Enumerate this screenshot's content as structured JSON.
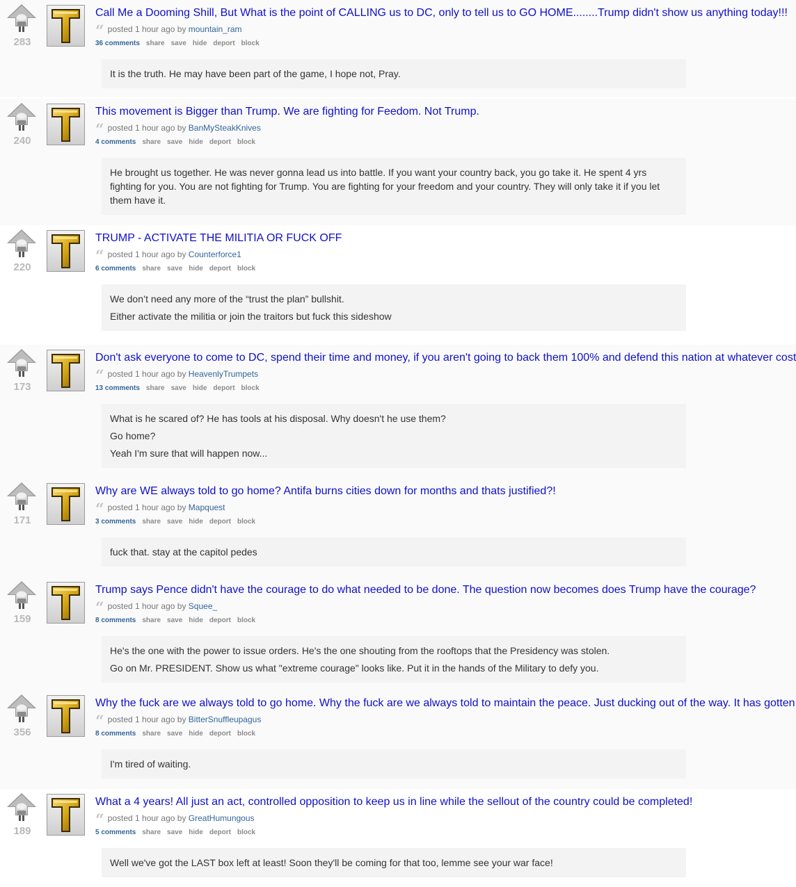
{
  "colors": {
    "title_link": "#1010c8",
    "author_link": "#336699",
    "score": "#b9b9b9",
    "body_background": "#f3f3f3",
    "thumbnail_gold": "#d4a514"
  },
  "icons": {
    "upvote": "upvote-arrow-icon",
    "quote": "quote-icon",
    "thumbnail": "gold-t-thumbnail-icon"
  },
  "labels": {
    "posted_prefix": "posted",
    "by": "by",
    "actions": [
      "share",
      "save",
      "hide",
      "deport",
      "block"
    ]
  },
  "posts": [
    {
      "score": "283",
      "title": "Call Me a Dooming Shill, But What is the point of CALLING us to DC, only to tell us to GO HOME........Trump didn't show us anything today!!!",
      "time": "1 hour ago",
      "author": "mountain_ram",
      "comments": "36 comments",
      "body": [
        "It is the truth. He may have been part of the game, I hope not, Pray."
      ]
    },
    {
      "score": "240",
      "title": "This movement is Bigger than Trump. We are fighting for Feedom. Not Trump.",
      "time": "1 hour ago",
      "author": "BanMySteakKnives",
      "comments": "4 comments",
      "body": [
        "He brought us together. He was never gonna lead us into battle. If you want your country back, you go take it. He spent 4 yrs fighting for you. You are not fighting for Trump. You are fighting for your freedom and your country. They will only take it if you let them have it."
      ]
    },
    {
      "score": "220",
      "title": "TRUMP - ACTIVATE THE MILITIA OR FUCK OFF",
      "time": "1 hour ago",
      "author": "Counterforce1",
      "comments": "6 comments",
      "body": [
        "We don’t need any more of the “trust the plan” bullshit.",
        "Either activate the militia or join the traitors but fuck this sideshow"
      ]
    },
    {
      "score": "173",
      "title": "Don't ask everyone to come to DC, spend their time and money, if you aren't going to back them 100% and defend this nation at whatever cost",
      "time": "1 hour ago",
      "author": "HeavenlyTrumpets",
      "comments": "13 comments",
      "body": [
        "What is he scared of? He has tools at his disposal. Why doesn't he use them?",
        "Go home?",
        "Yeah I'm sure that will happen now..."
      ]
    },
    {
      "score": "171",
      "title": "Why are WE always told to go home? Antifa burns cities down for months and thats justified?!",
      "time": "1 hour ago",
      "author": "Mapquest",
      "comments": "3 comments",
      "body": [
        "fuck that. stay at the capitol pedes"
      ]
    },
    {
      "score": "159",
      "title": "Trump says Pence didn't have the courage to do what needed to be done. The question now becomes does Trump have the courage?",
      "time": "1 hour ago",
      "author": "Squee_",
      "comments": "8 comments",
      "body": [
        "He's the one with the power to issue orders. He's the one shouting from the rooftops that the Presidency was stolen.",
        "Go on Mr. PRESIDENT. Show us what \"extreme courage\" looks like. Put it in the hands of the Military to defy you."
      ]
    },
    {
      "score": "356",
      "title": "Why the fuck are we always told to go home. Why the fuck are we always told to maintain the peace. Just ducking out of the way. It has gotten",
      "time": "1 hour ago",
      "author": "BitterSnuffleupagus",
      "comments": "8 comments",
      "body": [
        "I'm tired of waiting."
      ]
    },
    {
      "score": "189",
      "title": "What a 4 years! All just an act, controlled opposition to keep us in line while the sellout of the country could be completed!",
      "time": "1 hour ago",
      "author": "GreatHumungous",
      "comments": "5 comments",
      "body": [
        "Well we've got the LAST box left at least! Soon they'll be coming for that too, lemme see your war face!"
      ]
    }
  ]
}
